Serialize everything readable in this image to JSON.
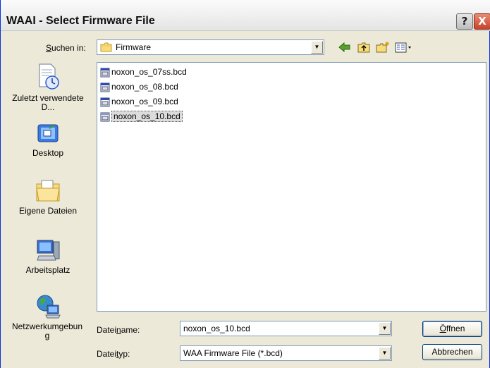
{
  "window": {
    "title": "WAAI - Select Firmware File",
    "help_label": "?",
    "close_label": "X"
  },
  "lookin": {
    "label_prefix": "S",
    "label_rest": "uchen in:",
    "value": "Firmware"
  },
  "places": [
    {
      "label": "Zuletzt verwendete D...",
      "icon": "recent-documents-icon"
    },
    {
      "label": "Desktop",
      "icon": "desktop-icon"
    },
    {
      "label": "Eigene Dateien",
      "icon": "my-documents-icon"
    },
    {
      "label": "Arbeitsplatz",
      "icon": "my-computer-icon"
    },
    {
      "label": "Netzwerkumgebung",
      "icon": "network-places-icon"
    }
  ],
  "files": [
    {
      "name": "noxon_os_07ss.bcd",
      "selected": false
    },
    {
      "name": "noxon_os_08.bcd",
      "selected": false
    },
    {
      "name": "noxon_os_09.bcd",
      "selected": false
    },
    {
      "name": "noxon_os_10.bcd",
      "selected": true
    }
  ],
  "filename": {
    "label_a": "Datei",
    "label_u": "n",
    "label_b": "ame:",
    "value": "noxon_os_10.bcd"
  },
  "filetype": {
    "label_a": "Datei",
    "label_u": "t",
    "label_b": "yp:",
    "value": "WAA Firmware File (*.bcd)"
  },
  "buttons": {
    "open_u": "Ö",
    "open_rest": "ffnen",
    "cancel": "Abbrechen"
  },
  "colors": {
    "accent": "#0831d9",
    "selection": "#dcdcdc"
  }
}
